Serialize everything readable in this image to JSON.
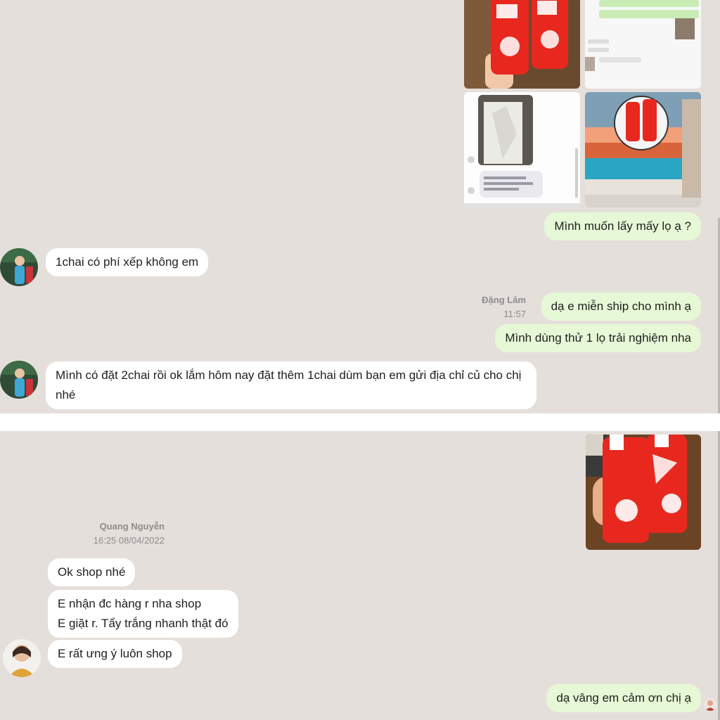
{
  "top_chat": {
    "messages": [
      {
        "text": "Mình muốn lấy mấy lọ ạ ?"
      },
      {
        "text": "1chai có phí xếp không em"
      },
      {
        "text": "dạ e miễn ship cho mình ạ"
      },
      {
        "text": "Mình dùng thử 1 lọ trải nghiệm nha"
      },
      {
        "text": "Mình có đặt 2chai rồi ok lắm hôm nay đặt thêm 1chai dùm bạn em gửi địa chỉ củ cho chị nhé"
      }
    ],
    "sender_name": "Đặng Lâm",
    "sender_time": "11:57"
  },
  "bottom_chat": {
    "sender_name": "Quang Nguyễn",
    "sender_time": "16:25 08/04/2022",
    "messages": [
      {
        "text": "Ok shop nhé"
      },
      {
        "line1": "E nhận đc hàng r nha shop",
        "line2": "E giặt r. Tẩy trắng nhanh thật đó"
      },
      {
        "text": "E rất ưng ý luôn shop"
      },
      {
        "text": "dạ vâng em cảm ơn chị ạ"
      }
    ]
  },
  "colors": {
    "chat_background": "#e5dfdb",
    "incoming_bubble": "#ffffff",
    "outgoing_bubble": "#e6f8d6",
    "product_red": "#e8281f"
  },
  "icons": {
    "customer_avatar": "avatar",
    "shop_avatar": "avatar"
  }
}
